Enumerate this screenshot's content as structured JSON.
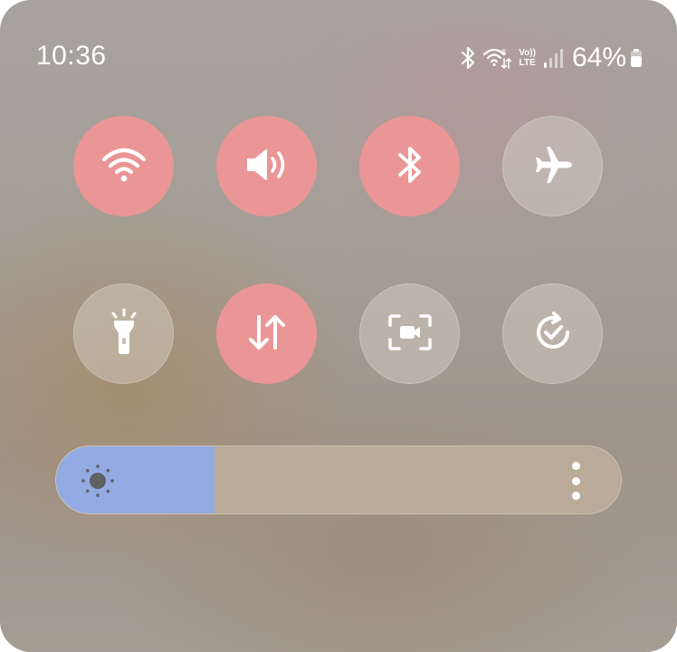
{
  "status_bar": {
    "time": "10:36",
    "battery_percent": "64%",
    "icons": [
      "bluetooth-icon",
      "wifi-6-data-icon",
      "volte-icon",
      "signal-strength-icon",
      "battery-icon"
    ],
    "volte_top": "Vo))",
    "volte_bottom": "LTE"
  },
  "quick_toggles": [
    {
      "id": "wifi",
      "icon": "wifi-icon",
      "active": true
    },
    {
      "id": "sound",
      "icon": "speaker-icon",
      "active": true
    },
    {
      "id": "bluetooth",
      "icon": "bluetooth-icon",
      "active": true
    },
    {
      "id": "airplane",
      "icon": "airplane-icon",
      "active": false
    },
    {
      "id": "flashlight",
      "icon": "flashlight-icon",
      "active": false
    },
    {
      "id": "mobile-data",
      "icon": "data-transfer-icon",
      "active": true
    },
    {
      "id": "screen-recorder",
      "icon": "screen-record-icon",
      "active": false
    },
    {
      "id": "auto-rotate",
      "icon": "rotate-check-icon",
      "active": false
    }
  ],
  "brightness": {
    "level": 0.28,
    "icon": "sun-icon",
    "menu_icon": "more-vertical-icon"
  },
  "colors": {
    "active_toggle": "#ea9696",
    "brightness_fill": "#93abe2",
    "brightness_track": "#b9ab98"
  }
}
